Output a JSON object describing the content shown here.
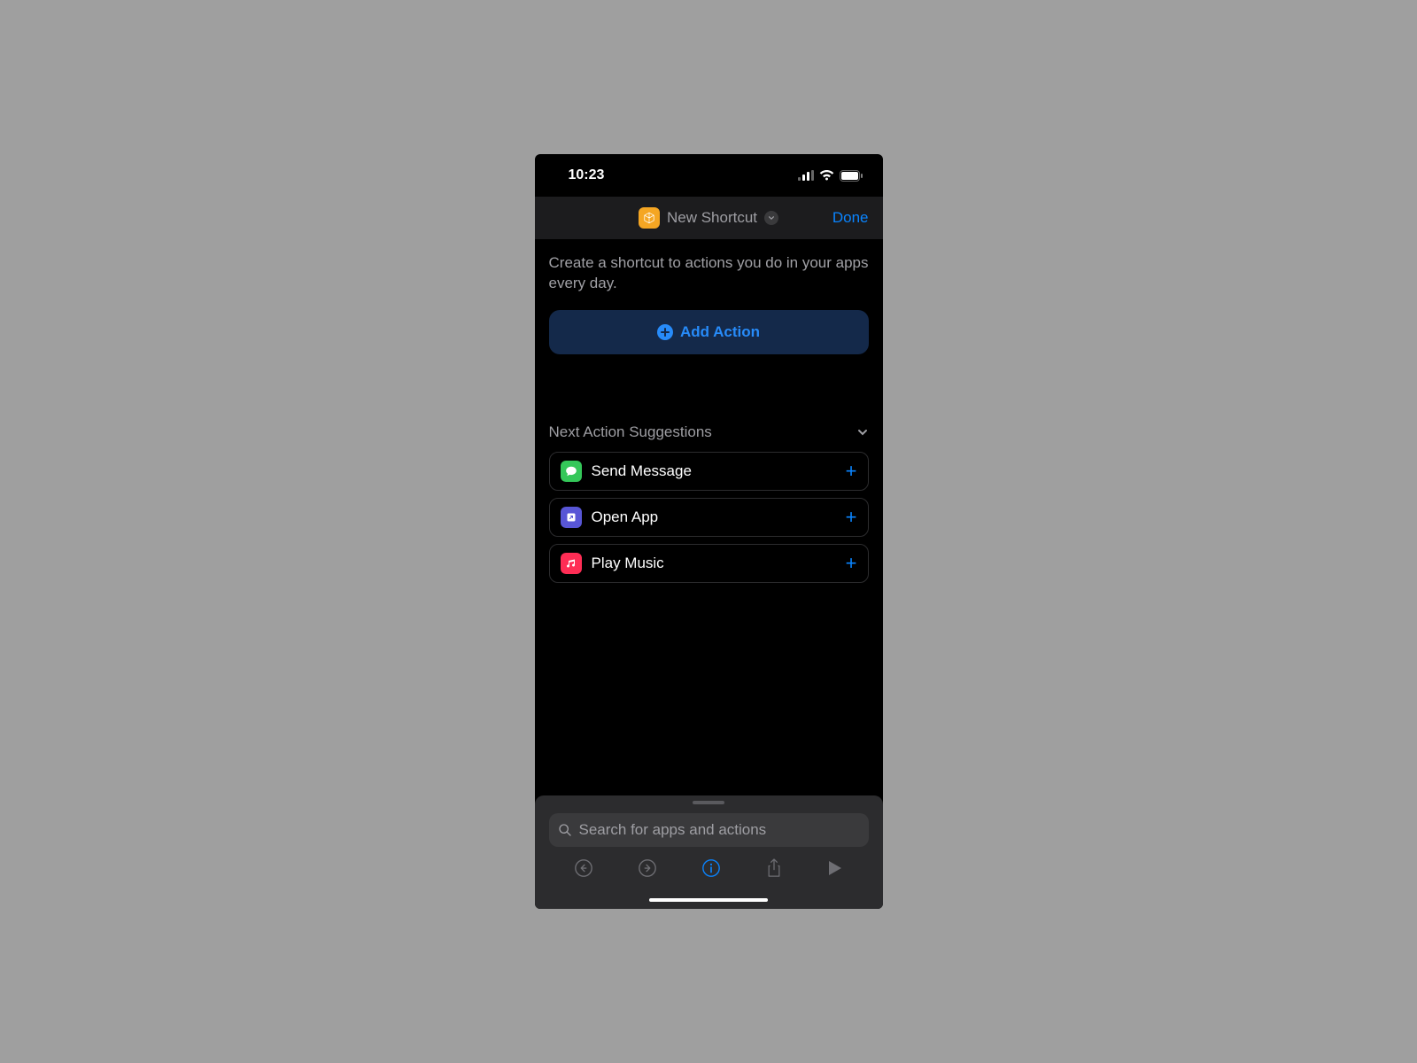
{
  "status_bar": {
    "time": "10:23"
  },
  "nav": {
    "title": "New Shortcut",
    "done_label": "Done"
  },
  "content": {
    "description": "Create a shortcut to actions you do in your apps every day.",
    "add_action_label": "Add Action"
  },
  "suggestions": {
    "section_title": "Next Action Suggestions",
    "items": [
      {
        "app": "messages",
        "label": "Send Message"
      },
      {
        "app": "shortcuts",
        "label": "Open App"
      },
      {
        "app": "music",
        "label": "Play Music"
      }
    ]
  },
  "search": {
    "placeholder": "Search for apps and actions"
  }
}
